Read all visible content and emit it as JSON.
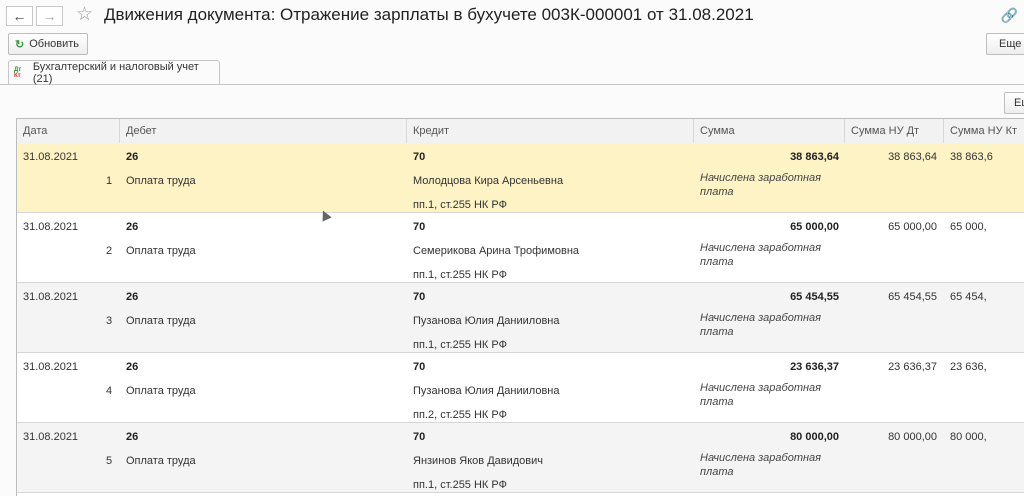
{
  "window": {
    "title": "Движения документа: Отражение зарплаты в бухучете 003К-000001 от 31.08.2021",
    "back_icon": "←",
    "forward_icon": "→",
    "star_icon": "☆",
    "link_icon": "🔗"
  },
  "toolbar": {
    "refresh_icon": "↻",
    "refresh_label": "Обновить",
    "more_label": "Еще",
    "more_label_inner": "Ещ"
  },
  "tab": {
    "icon_top": "Дт",
    "icon_bottom": "Кт",
    "label": "Бухгалтерский и налоговый учет (21)"
  },
  "table": {
    "columns": [
      "Дата",
      "Дебет",
      "Кредит",
      "Сумма",
      "Сумма НУ Дт",
      "Сумма НУ Кт"
    ],
    "rows": [
      {
        "date": "31.08.2021",
        "n": "1",
        "debit": "26",
        "debit_sub": "Оплата труда",
        "credit": "70",
        "credit_sub1": "Молодцова Кира Арсеньевна",
        "credit_sub2": "пп.1, ст.255 НК РФ",
        "sum": "38 863,64",
        "desc": "Начислена заработная плата",
        "nu_dt": "38 863,64",
        "nu_kt": "38 863,6"
      },
      {
        "date": "31.08.2021",
        "n": "2",
        "debit": "26",
        "debit_sub": "Оплата труда",
        "credit": "70",
        "credit_sub1": "Семерикова Арина Трофимовна",
        "credit_sub2": "пп.1, ст.255 НК РФ",
        "sum": "65 000,00",
        "desc": "Начислена заработная плата",
        "nu_dt": "65 000,00",
        "nu_kt": "65 000,"
      },
      {
        "date": "31.08.2021",
        "n": "3",
        "debit": "26",
        "debit_sub": "Оплата труда",
        "credit": "70",
        "credit_sub1": "Пузанова Юлия Данииловна",
        "credit_sub2": "пп.1, ст.255 НК РФ",
        "sum": "65 454,55",
        "desc": "Начислена заработная плата",
        "nu_dt": "65 454,55",
        "nu_kt": "65 454,"
      },
      {
        "date": "31.08.2021",
        "n": "4",
        "debit": "26",
        "debit_sub": "Оплата труда",
        "credit": "70",
        "credit_sub1": "Пузанова Юлия Данииловна",
        "credit_sub2": "пп.2, ст.255 НК РФ",
        "sum": "23 636,37",
        "desc": "Начислена заработная плата",
        "nu_dt": "23 636,37",
        "nu_kt": "23 636,"
      },
      {
        "date": "31.08.2021",
        "n": "5",
        "debit": "26",
        "debit_sub": "Оплата труда",
        "credit": "70",
        "credit_sub1": "Янзинов Яков Давидович",
        "credit_sub2": "пп.1, ст.255 НК РФ",
        "sum": "80 000,00",
        "desc": "Начислена заработная плата",
        "nu_dt": "80 000,00",
        "nu_kt": "80 000,"
      }
    ]
  }
}
